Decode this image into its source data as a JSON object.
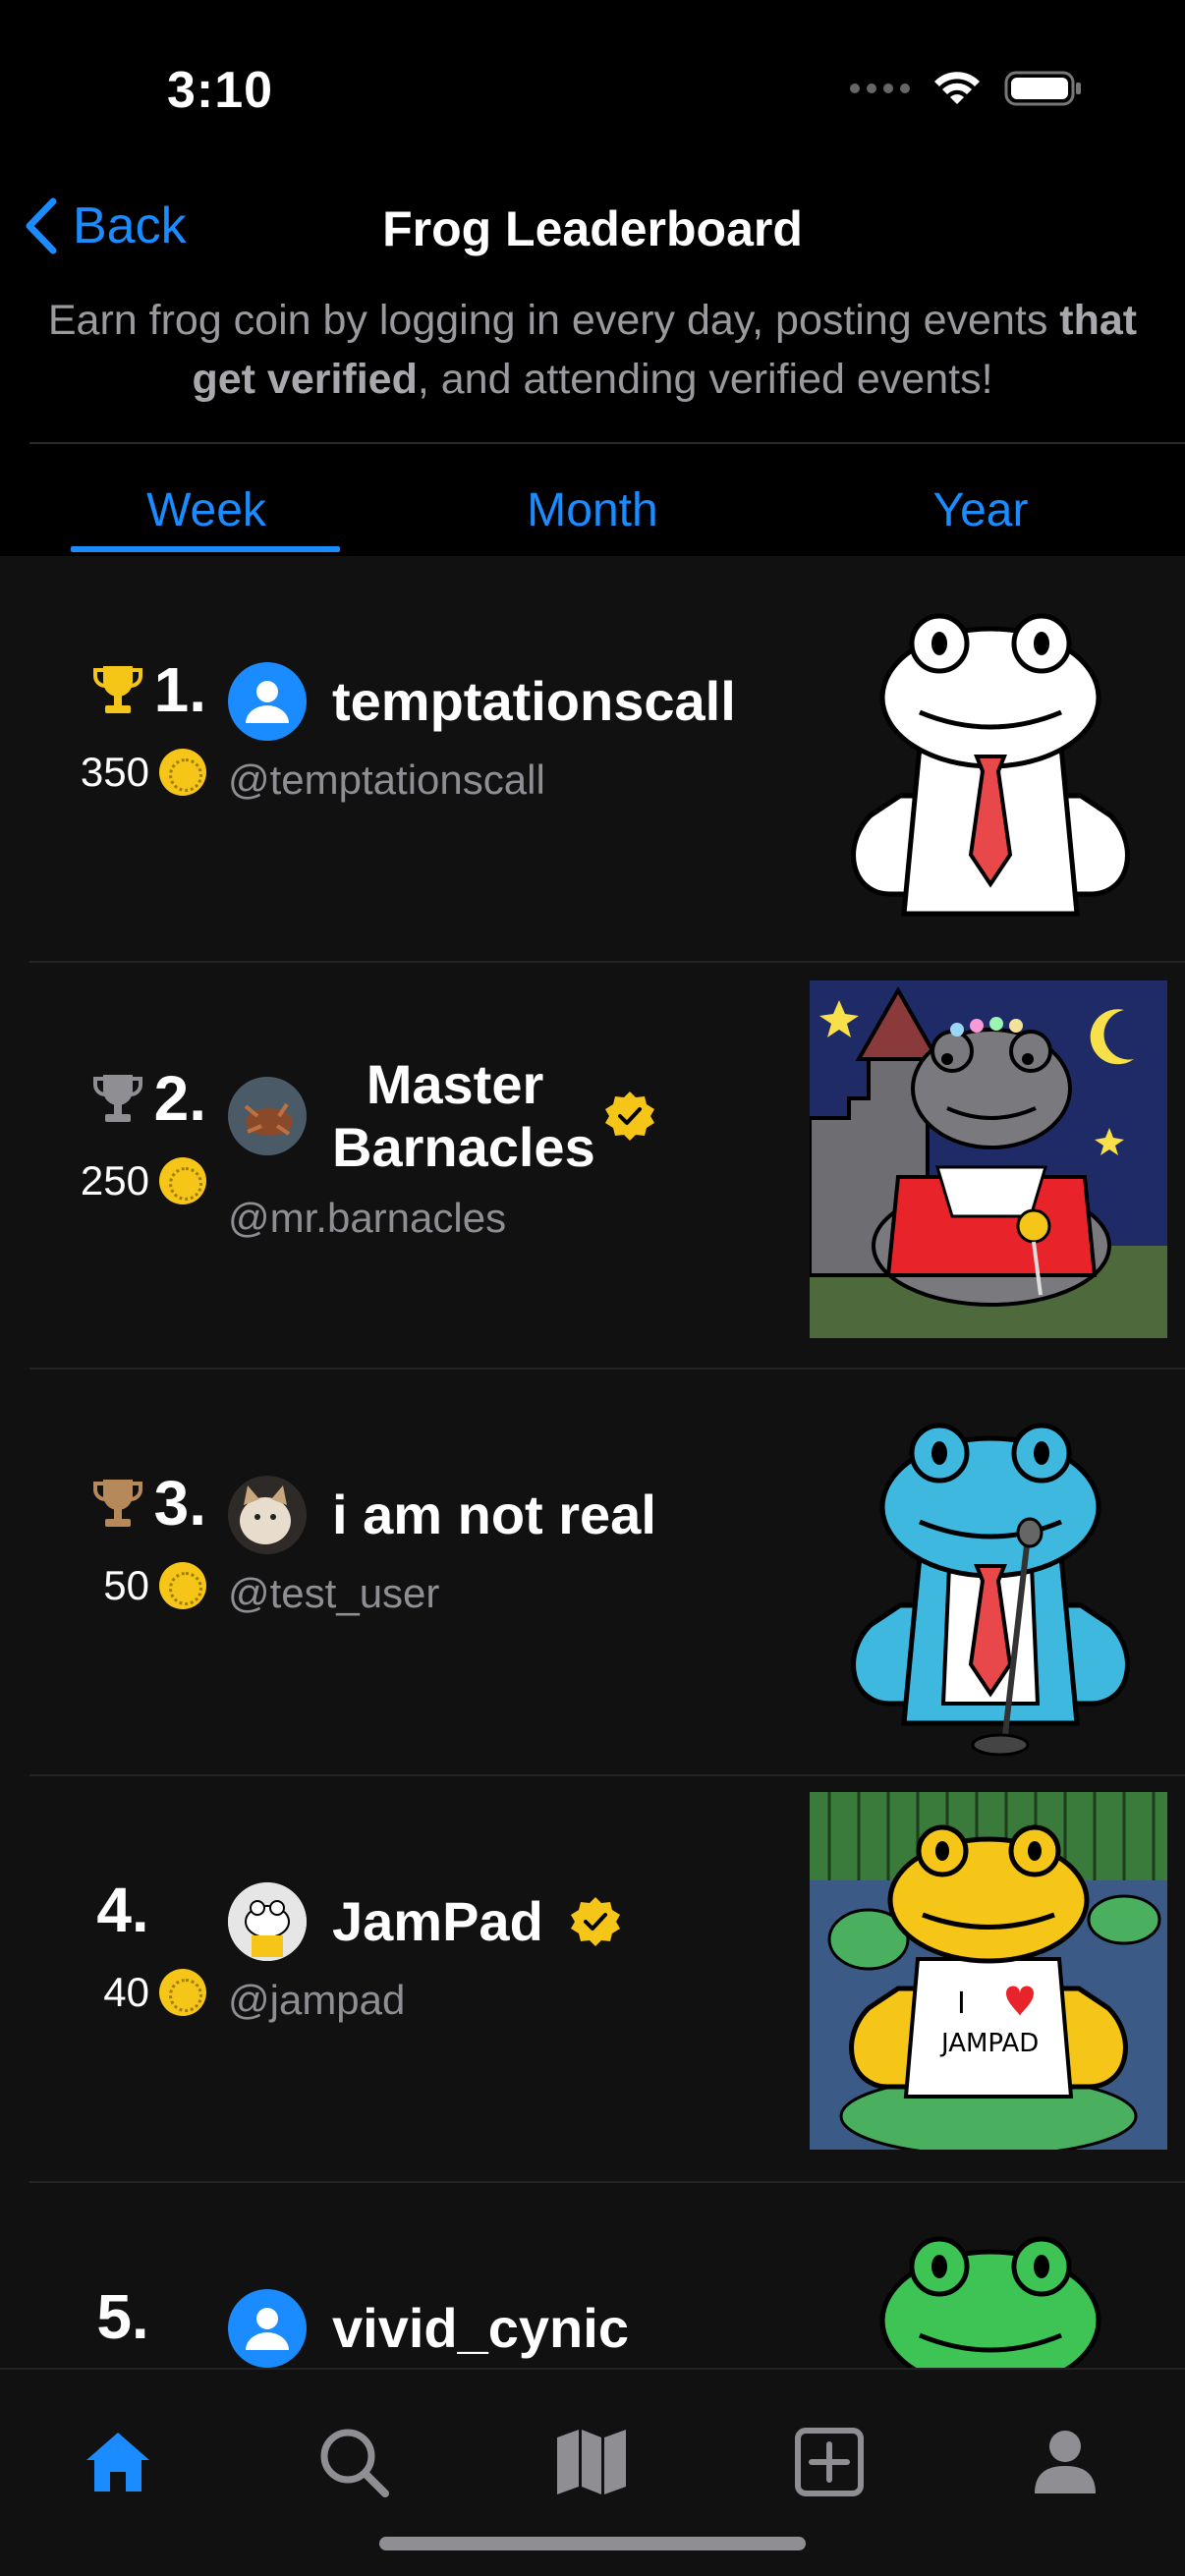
{
  "status": {
    "time": "3:10"
  },
  "nav": {
    "back_label": "Back",
    "title": "Frog Leaderboard"
  },
  "subtitle": {
    "part1": "Earn frog coin by logging in every day, posting events",
    "bold": "that get verified",
    "part2": ", and attending verified events!"
  },
  "tabs": [
    {
      "label": "Week",
      "selected": true
    },
    {
      "label": "Month",
      "selected": false
    },
    {
      "label": "Year",
      "selected": false
    }
  ],
  "entries": [
    {
      "rank": "1.",
      "coins": "350",
      "trophy": "gold",
      "display_name": "temptationscall",
      "handle": "@temptationscall",
      "verified": false,
      "avatar": "default-avatar"
    },
    {
      "rank": "2.",
      "coins": "250",
      "trophy": "silver",
      "display_name": "Master Barnacles",
      "handle": "@mr.barnacles",
      "verified": true,
      "avatar": "crab-photo"
    },
    {
      "rank": "3.",
      "coins": "50",
      "trophy": "bronze",
      "display_name": "i am not real",
      "handle": "@test_user",
      "verified": false,
      "avatar": "cat-photo"
    },
    {
      "rank": "4.",
      "coins": "40",
      "trophy": "none",
      "display_name": "JamPad",
      "handle": "@jampad",
      "verified": true,
      "avatar": "frog-avatar"
    },
    {
      "rank": "5.",
      "coins": "",
      "trophy": "none",
      "display_name": "vivid_cynic",
      "handle": "",
      "verified": false,
      "avatar": "default-avatar"
    }
  ],
  "art_texts": {
    "shirt_line1": "I",
    "shirt_line2": "JAMPAD"
  },
  "tabbar": [
    {
      "icon": "home-icon",
      "active": true
    },
    {
      "icon": "search-icon",
      "active": false
    },
    {
      "icon": "map-icon",
      "active": false
    },
    {
      "icon": "add-icon",
      "active": false
    },
    {
      "icon": "profile-icon",
      "active": false
    }
  ],
  "colors": {
    "accent": "#1a8cff",
    "gold": "#f5c518",
    "silver": "#8e8e93",
    "bronze": "#b5895a",
    "background": "#000000",
    "list_background": "#111112"
  }
}
